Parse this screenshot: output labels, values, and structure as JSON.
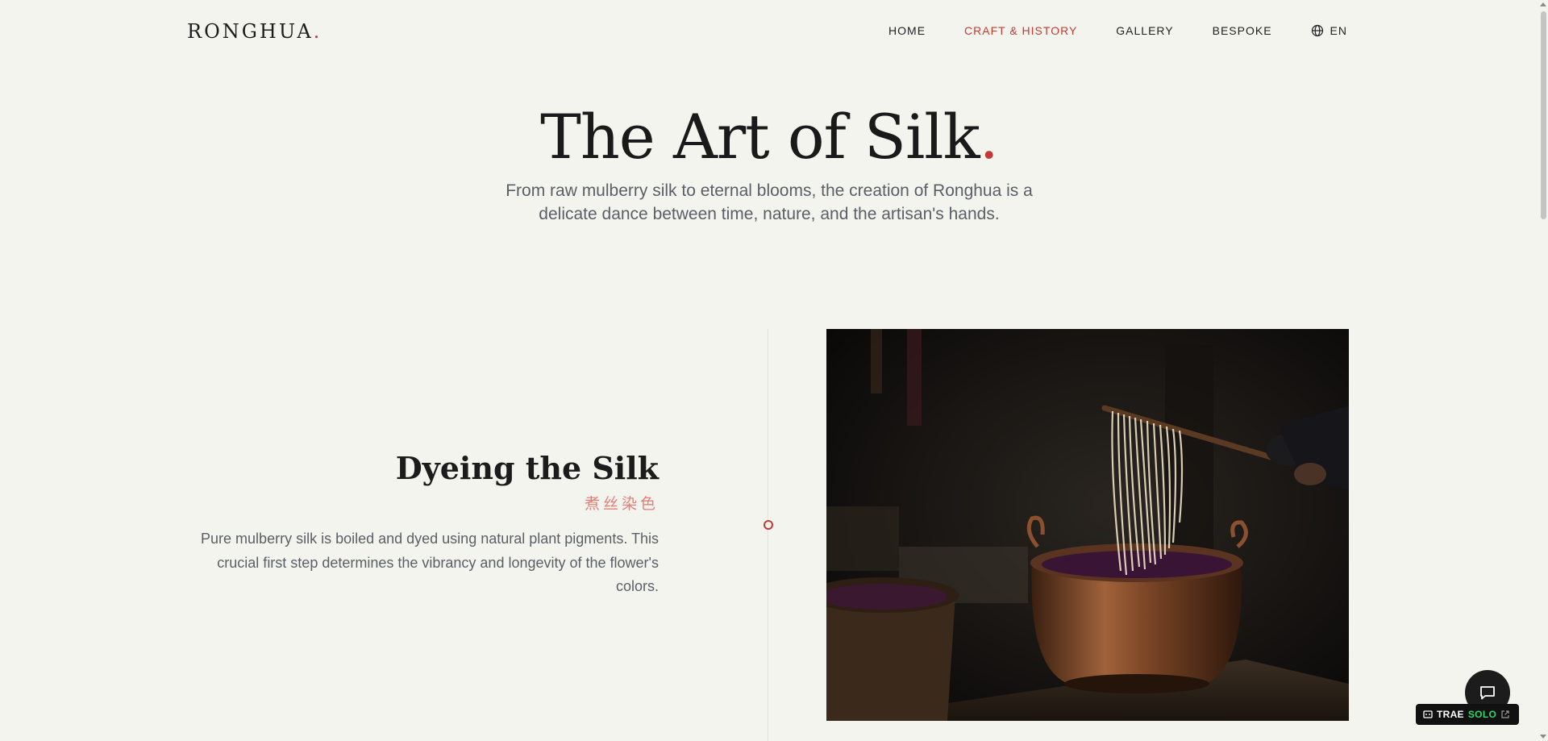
{
  "brand": {
    "name": "RONGHUA",
    "dot": ".",
    "accent_color": "#c23a32"
  },
  "nav": {
    "items": [
      {
        "label": "HOME",
        "active": false
      },
      {
        "label": "CRAFT & HISTORY",
        "active": true
      },
      {
        "label": "GALLERY",
        "active": false
      },
      {
        "label": "BESPOKE",
        "active": false
      }
    ],
    "language": {
      "icon": "globe-icon",
      "label": "EN"
    }
  },
  "hero": {
    "title": "The Art of Silk",
    "title_dot": ".",
    "subtitle": "From raw mulberry silk to eternal blooms, the creation of Ronghua is a delicate dance between time, nature, and the artisan's hands."
  },
  "step": {
    "title": "Dyeing the Silk",
    "subtitle_cn": "煮丝染色",
    "description": "Pure mulberry silk is boiled and dyed using natural plant pigments. This crucial first step determines the vibrancy and longevity of the flower's colors.",
    "image_alt": "Copper pot of dye with skeins of silk lifted on a wooden stick"
  },
  "widgets": {
    "chat_icon": "chat-bubble-icon",
    "badge": {
      "part1": "TRAE",
      "part2": "SOLO",
      "icon": "external-link-icon"
    }
  }
}
